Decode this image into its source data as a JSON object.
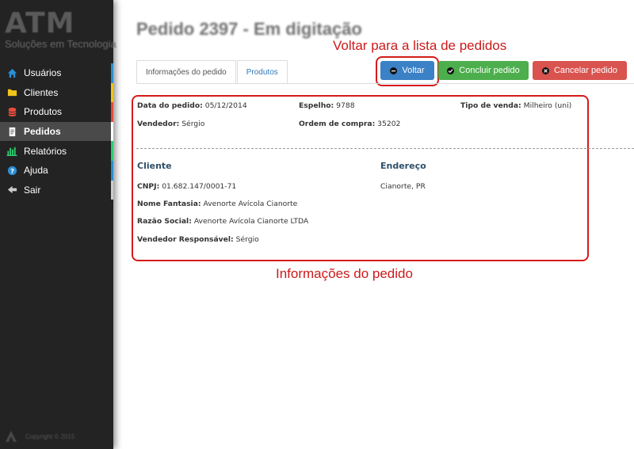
{
  "sidebar": {
    "logo_text": "ATM",
    "logo_subtitle": "Soluções em Tecnologia",
    "items": [
      {
        "label": "Usuários",
        "icon": "home-icon",
        "accent": "#2a8fd6"
      },
      {
        "label": "Clientes",
        "icon": "folder-icon",
        "accent": "#f0c419"
      },
      {
        "label": "Produtos",
        "icon": "database-icon",
        "accent": "#e74c3c"
      },
      {
        "label": "Pedidos",
        "icon": "document-icon",
        "accent": "#ffffff",
        "active": true
      },
      {
        "label": "Relatórios",
        "icon": "bar-chart-icon",
        "accent": "#2ecc71"
      },
      {
        "label": "Ajuda",
        "icon": "help-icon",
        "accent": "#2a8fd6"
      },
      {
        "label": "Sair",
        "icon": "arrow-left-icon",
        "accent": "#cccccc"
      }
    ],
    "copyright": "Copyright © 2015"
  },
  "header": {
    "title": "Pedido 2397 - Em digitação"
  },
  "annotations": {
    "top": "Voltar para a lista de pedidos",
    "bottom": "Informações do pedido"
  },
  "tabs": [
    {
      "label": "Informações do pedido",
      "active": true
    },
    {
      "label": "Produtos",
      "active": false
    }
  ],
  "buttons": {
    "voltar": "Voltar",
    "concluir": "Concluir pedido",
    "cancelar": "Cancelar pedido"
  },
  "order": {
    "data_label": "Data do pedido:",
    "data_value": "05/12/2014",
    "espelho_label": "Espelho:",
    "espelho_value": "9788",
    "tipo_label": "Tipo de venda:",
    "tipo_value": "Milheiro (uni)",
    "vendedor_label": "Vendedor:",
    "vendedor_value": "Sérgio",
    "ordem_label": "Ordem de compra:",
    "ordem_value": "35202"
  },
  "cliente": {
    "title": "Cliente",
    "cnpj_label": "CNPJ:",
    "cnpj_value": "01.682.147/0001-71",
    "fantasia_label": "Nome Fantasia:",
    "fantasia_value": "Avenorte Avícola Cianorte",
    "razao_label": "Razão Social:",
    "razao_value": "Avenorte Avícola Cianorte LTDA",
    "vendedor_label": "Vendedor Responsável:",
    "vendedor_value": "Sérgio"
  },
  "endereco": {
    "title": "Endereço",
    "value": "Cianorte, PR"
  },
  "colors": {
    "sidebar_bg": "#232323",
    "annotation_red": "#d61a1a",
    "primary": "#3a81c6",
    "success": "#4cae4c",
    "danger": "#d9534f"
  }
}
